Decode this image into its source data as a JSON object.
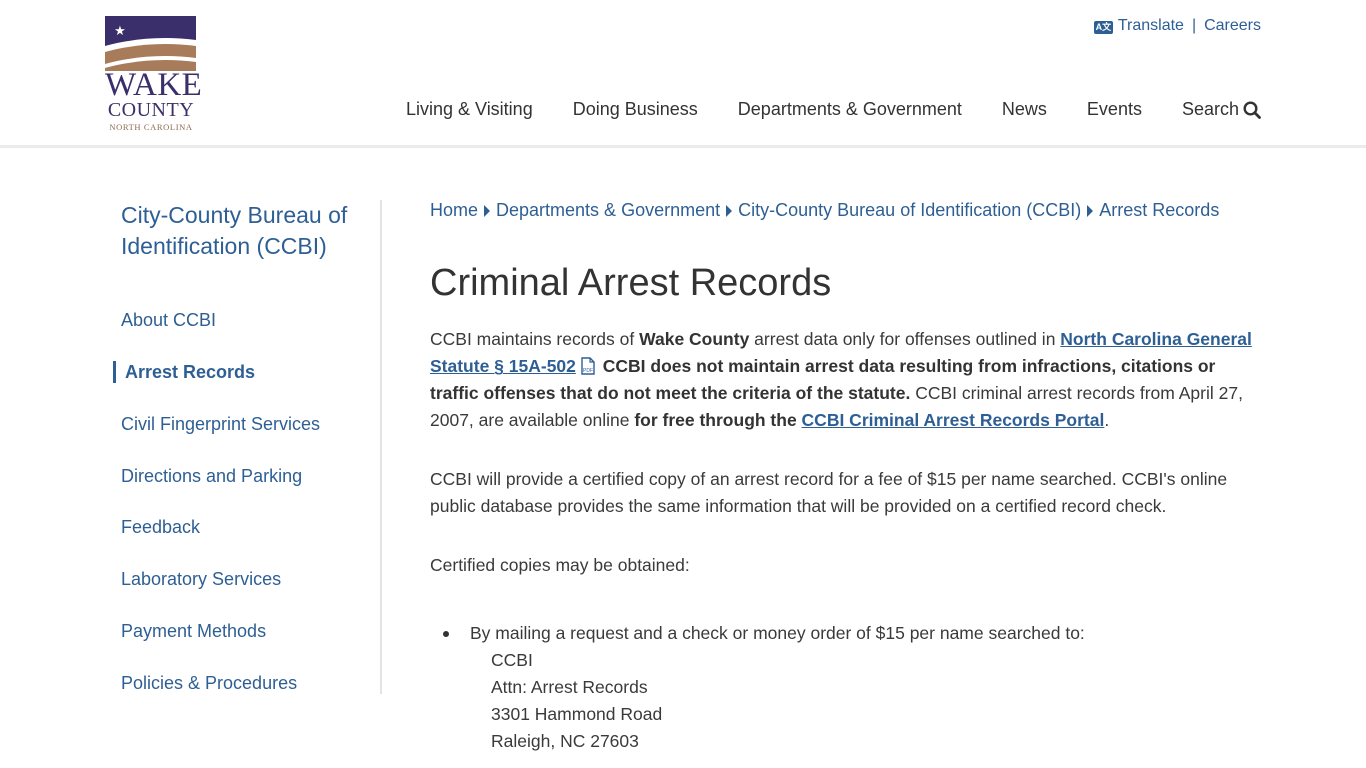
{
  "logo": {
    "line1": "WAKE",
    "line2": "COUNTY",
    "line3": "NORTH CAROLINA",
    "star": "★"
  },
  "utility": {
    "translate_icon": "A文",
    "translate": "Translate",
    "separator": "|",
    "careers": "Careers"
  },
  "nav": {
    "items": [
      "Living & Visiting",
      "Doing Business",
      "Departments & Government",
      "News",
      "Events"
    ],
    "search": "Search"
  },
  "sidebar": {
    "title": "City-County Bureau of Identification (CCBI)",
    "items": [
      {
        "label": "About CCBI",
        "active": false
      },
      {
        "label": "Arrest Records",
        "active": true
      },
      {
        "label": "Civil Fingerprint Services",
        "active": false
      },
      {
        "label": "Directions and Parking",
        "active": false
      },
      {
        "label": "Feedback",
        "active": false
      },
      {
        "label": "Laboratory Services",
        "active": false
      },
      {
        "label": "Payment Methods",
        "active": false
      },
      {
        "label": "Policies & Procedures",
        "active": false
      }
    ]
  },
  "breadcrumbs": [
    "Home",
    "Departments & Government",
    "City-County Bureau of Identification (CCBI)",
    "Arrest Records"
  ],
  "page": {
    "title": "Criminal Arrest Records",
    "p1": {
      "t1": "CCBI maintains records of ",
      "b1": "Wake County",
      "t2": " arrest data only for offenses outlined in ",
      "link1": "North Carolina General Statute § 15A-502",
      "b2": " CCBI does not maintain arrest data resulting from infractions, citations or traffic offenses that do not meet the criteria of the statute.",
      "t3": " CCBI criminal arrest records from April 27, 2007, are available online ",
      "b3": "for free through the ",
      "link2": "CCBI Criminal Arrest Records Portal",
      "t4": "."
    },
    "p2": "CCBI will provide a certified copy of an arrest record for a fee of $15 per name searched. CCBI's online public database provides the same information that will be provided on a certified record check.",
    "p3": "Certified copies may be obtained:",
    "bullet1": "By mailing a request and a check or money order of $15 per name searched to:",
    "address": [
      "CCBI",
      "Attn: Arrest Records",
      "3301 Hammond Road",
      "Raleigh, NC 27603"
    ]
  },
  "colors": {
    "link": "#2e5f94",
    "logo_purple": "#3a2f6b",
    "logo_brown": "#a87b5a"
  }
}
